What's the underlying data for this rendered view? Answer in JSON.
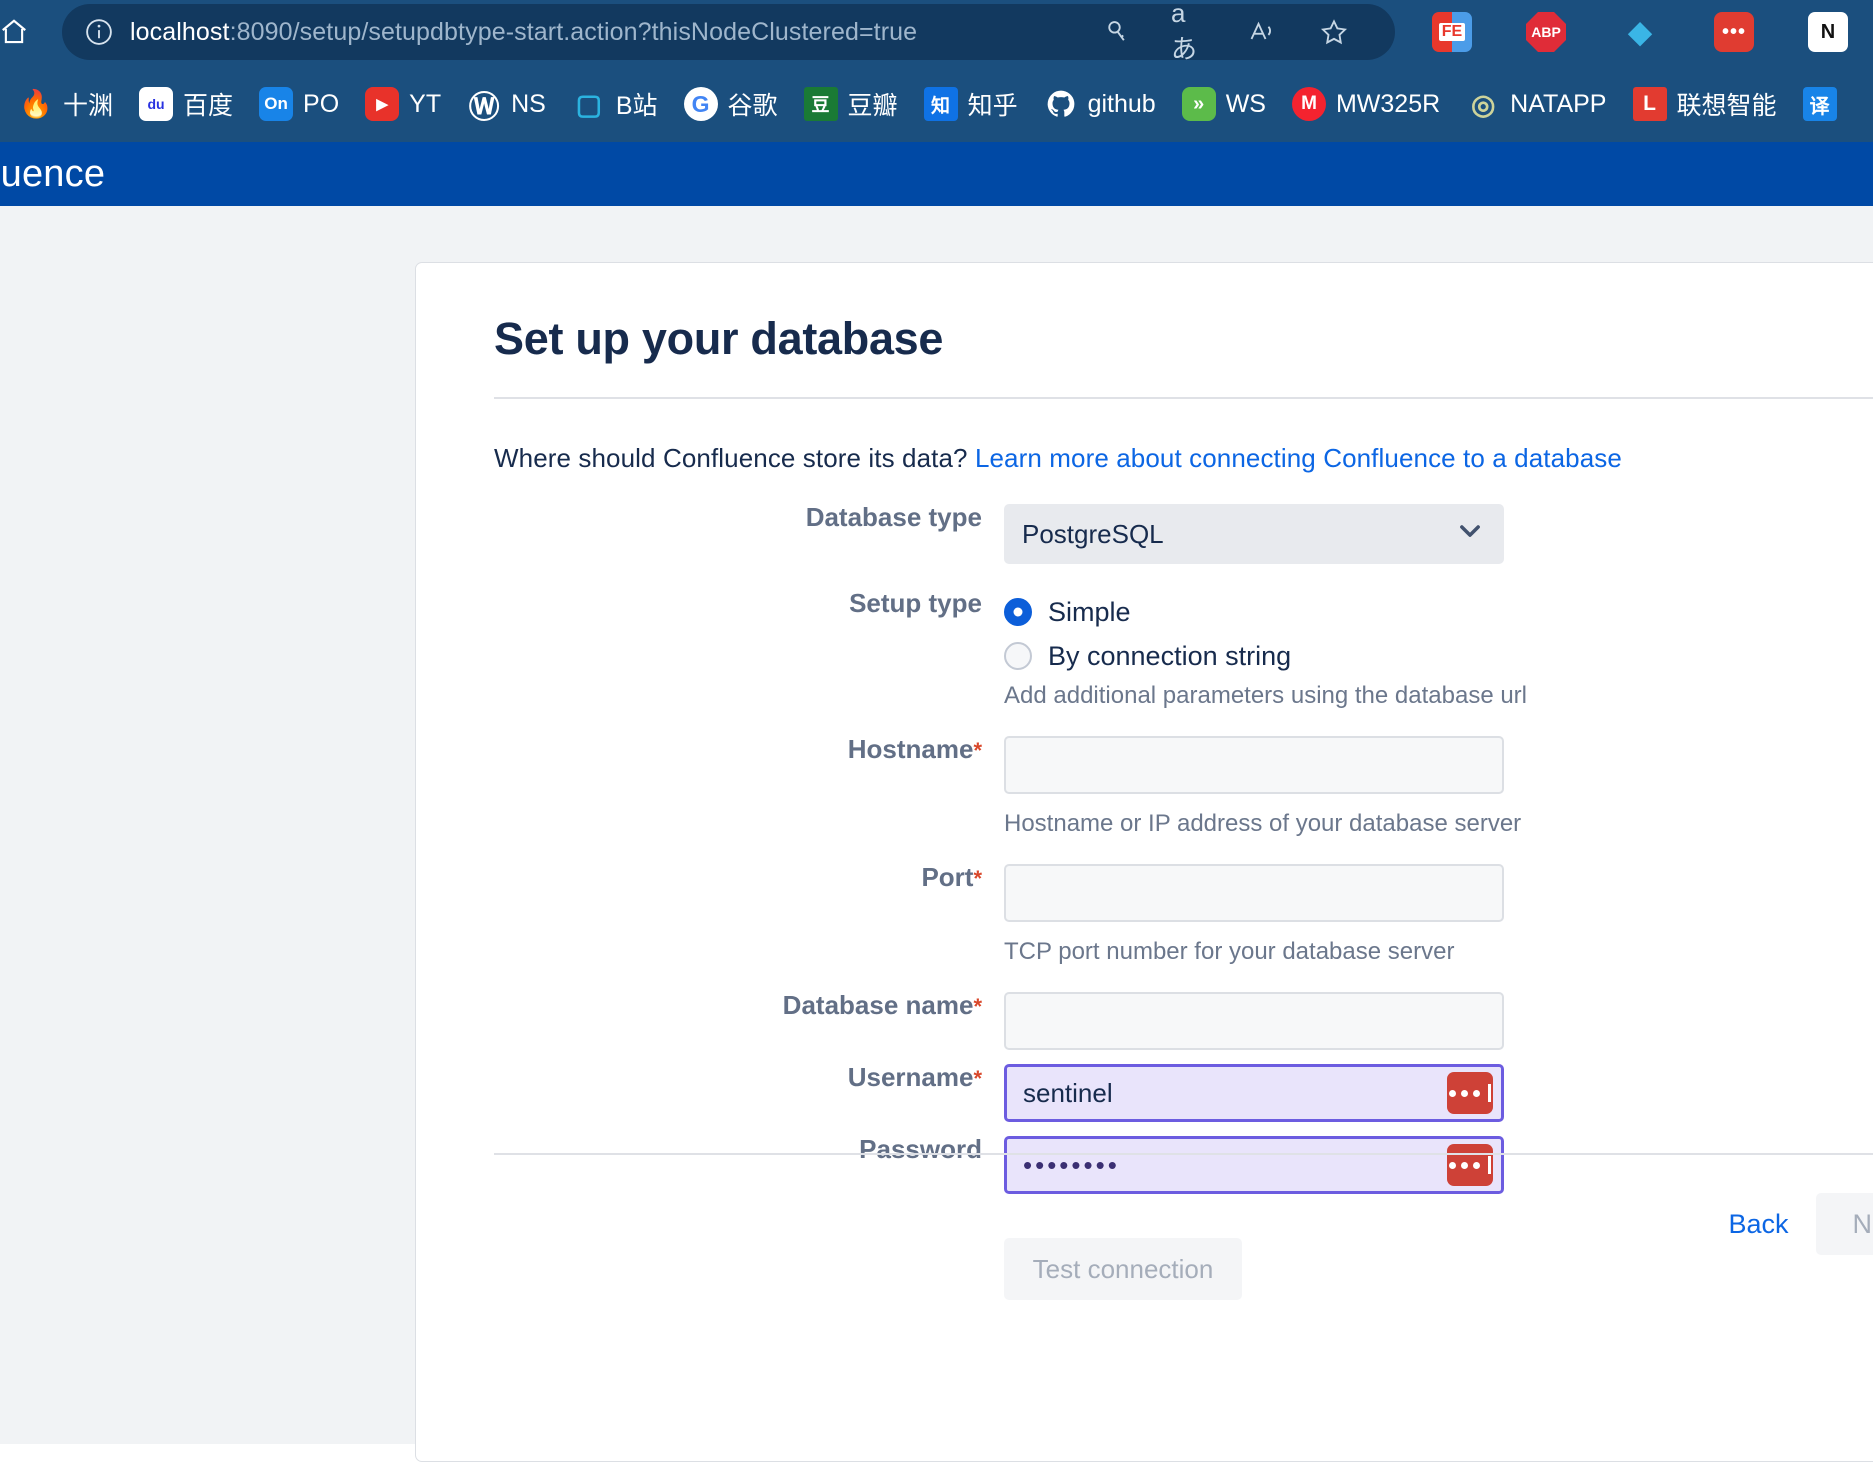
{
  "browser": {
    "home_icon": "home-icon",
    "info_icon": "info-icon",
    "url_host": "localhost",
    "url_rest": ":8090/setup/setupdbtype-start.action?thisNodeClustered=true",
    "omni_actions": [
      {
        "name": "key-icon",
        "glyph": "⚷"
      },
      {
        "name": "translate-icon",
        "glyph": "aあ"
      },
      {
        "name": "read-aloud-icon",
        "glyph": "A"
      },
      {
        "name": "favorite-star-icon",
        "glyph": "☆"
      }
    ],
    "extensions": [
      {
        "name": "ext-fastestube-icon",
        "label": "FE"
      },
      {
        "name": "ext-adblockplus-icon",
        "label": "ABP"
      },
      {
        "name": "ext-diamond-icon",
        "label": "◆"
      },
      {
        "name": "ext-dots-icon",
        "label": "•••"
      },
      {
        "name": "ext-onenote-icon",
        "label": "N"
      }
    ]
  },
  "bookmarks": [
    {
      "name": "bookmark-shiyuan",
      "label": "十渊",
      "icon": "🔥",
      "cls": "bm-flame"
    },
    {
      "name": "bookmark-baidu",
      "label": "百度",
      "icon": "du",
      "cls": "bm-baidu"
    },
    {
      "name": "bookmark-po",
      "label": "PO",
      "icon": "On",
      "cls": "bm-on"
    },
    {
      "name": "bookmark-yt",
      "label": "YT",
      "icon": "▶",
      "cls": "bm-yt"
    },
    {
      "name": "bookmark-ns",
      "label": "NS",
      "icon": "Ⓦ",
      "cls": "bm-wp"
    },
    {
      "name": "bookmark-bilibili",
      "label": "B站",
      "icon": "▢",
      "cls": "bm-bili"
    },
    {
      "name": "bookmark-google",
      "label": "谷歌",
      "icon": "G",
      "cls": "bm-google"
    },
    {
      "name": "bookmark-douban",
      "label": "豆瓣",
      "icon": "豆",
      "cls": "bm-douban"
    },
    {
      "name": "bookmark-zhihu",
      "label": "知乎",
      "icon": "知",
      "cls": "bm-zhihu"
    },
    {
      "name": "bookmark-github",
      "label": "github",
      "icon": "●",
      "cls": "bm-github"
    },
    {
      "name": "bookmark-ws",
      "label": "WS",
      "icon": "»",
      "cls": "bm-ws"
    },
    {
      "name": "bookmark-mw325r",
      "label": "MW325R",
      "icon": "M",
      "cls": "bm-mw"
    },
    {
      "name": "bookmark-natapp",
      "label": "NATAPP",
      "icon": "◎",
      "cls": "bm-natapp"
    },
    {
      "name": "bookmark-lenovo",
      "label": "联想智能",
      "icon": "L",
      "cls": "bm-lenovo"
    },
    {
      "name": "bookmark-translate",
      "label": "",
      "icon": "译",
      "cls": "bm-yi"
    }
  ],
  "confluence": {
    "logo": "luence",
    "title": "Set up your database",
    "intro_text": "Where should Confluence store its data? ",
    "intro_link": "Learn more about connecting Confluence to a database",
    "fields": {
      "database_type_label": "Database type",
      "database_type_value": "PostgreSQL",
      "setup_type_label": "Setup type",
      "setup_simple": "Simple",
      "setup_connection_string": "By connection string",
      "setup_hint": "Add additional parameters using the database url",
      "hostname_label": "Hostname",
      "hostname_value": "",
      "hostname_hint": "Hostname or IP address of your database server",
      "port_label": "Port",
      "port_value": "",
      "port_hint": "TCP port number for your database server",
      "dbname_label": "Database name",
      "dbname_value": "",
      "username_label": "Username",
      "username_value": "sentinel",
      "password_label": "Password",
      "password_value": "••••••••",
      "required_marker": "*"
    },
    "test_connection_label": "Test connection",
    "back_label": "Back",
    "next_label": "Next"
  },
  "colors": {
    "confluence_blue": "#0049a5",
    "browser_blue": "#1b4f7e",
    "link_blue": "#0c66e4",
    "required_red": "#d9482b",
    "focus_purple": "#6c5ce0",
    "lastpass_red": "#ce4137"
  }
}
